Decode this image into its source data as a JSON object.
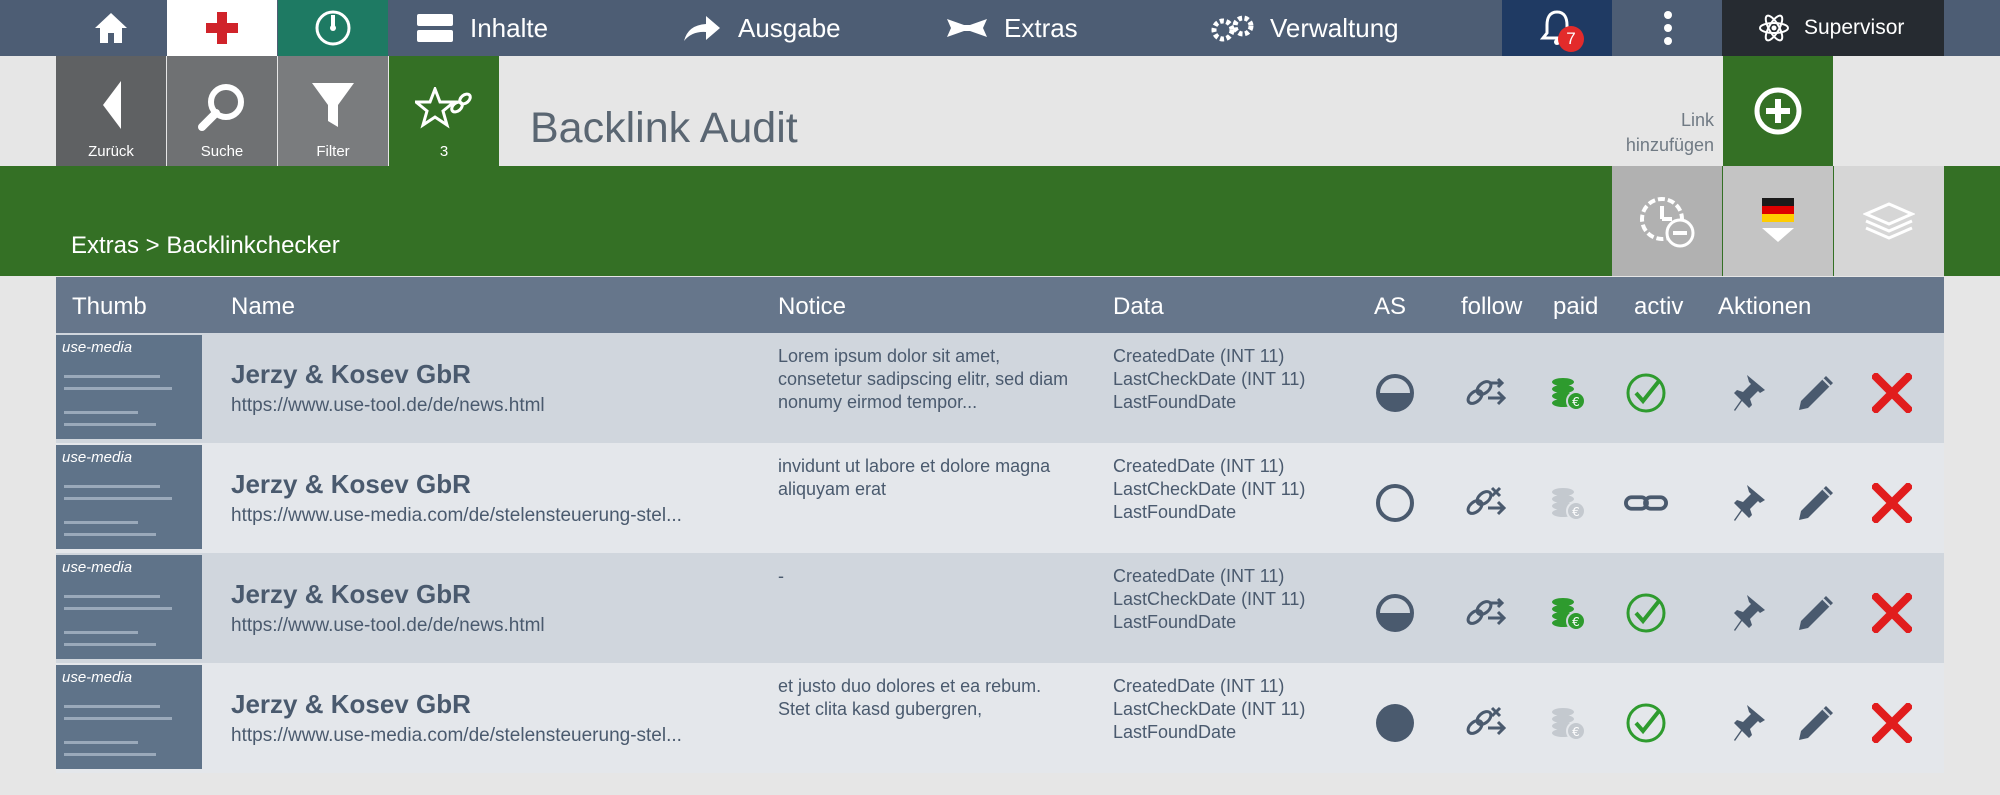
{
  "topnav": {
    "menu": [
      "Inhalte",
      "Ausgabe",
      "Extras",
      "Verwaltung"
    ],
    "notification_count": "7",
    "user": "Supervisor",
    "colors": {
      "bar": "#4d5d74",
      "active_red": "#e32b2b",
      "timer": "#1e7a63",
      "bell": "#1f3a63",
      "user": "#262b31"
    }
  },
  "toolbar": {
    "back_label": "Zurück",
    "search_label": "Suche",
    "filter_label": "Filter",
    "links_count": "3",
    "page_title": "Backlink Audit",
    "add_link_label_1": "Link",
    "add_link_label_2": "hinzufügen"
  },
  "breadcrumb": "Extras > Backlinkchecker",
  "table": {
    "headers": [
      "Thumb",
      "Name",
      "Notice",
      "Data",
      "AS",
      "follow",
      "paid",
      "activ",
      "Aktionen"
    ],
    "rows": [
      {
        "name": "Jerzy & Kosev GbR",
        "url": "https://www.use-tool.de/de/news.html",
        "notice": "Lorem ipsum dolor sit amet, consetetur sadipscing elitr, sed diam nonumy eirmod tempor...",
        "data": [
          "CreatedDate (INT 11)",
          "LastCheckDate (INT 11)",
          "LastFoundDate"
        ],
        "as": "half",
        "follow": "follow",
        "paid": true,
        "activ": true
      },
      {
        "name": "Jerzy & Kosev GbR",
        "url": "https://www.use-media.com/de/stelensteuerung-stel...",
        "notice": "invidunt ut labore et dolore magna aliquyam erat",
        "data": [
          "CreatedDate (INT 11)",
          "LastCheckDate (INT 11)",
          "LastFoundDate"
        ],
        "as": "empty",
        "follow": "nofollow",
        "paid": false,
        "activ": false
      },
      {
        "name": "Jerzy & Kosev GbR",
        "url": "https://www.use-tool.de/de/news.html",
        "notice": "-",
        "data": [
          "CreatedDate (INT 11)",
          "LastCheckDate (INT 11)",
          "LastFoundDate"
        ],
        "as": "half",
        "follow": "follow",
        "paid": true,
        "activ": true
      },
      {
        "name": "Jerzy & Kosev GbR",
        "url": "https://www.use-media.com/de/stelensteuerung-stel...",
        "notice": "et justo duo dolores et ea rebum. Stet clita kasd gubergren,",
        "data": [
          "CreatedDate (INT 11)",
          "LastCheckDate (INT 11)",
          "LastFoundDate"
        ],
        "as": "full",
        "follow": "nofollow",
        "paid": false,
        "activ": true
      }
    ]
  },
  "thumb_logo": "use-media",
  "icons": {
    "home": "home-icon",
    "add": "red-cross-icon",
    "timer": "timer-icon",
    "inhalte": "content-block-icon",
    "ausgabe": "share-arrow-icon",
    "extras": "ribbon-icon",
    "verwaltung": "gears-icon",
    "bell": "bell-icon",
    "more": "kebab-menu-icon",
    "user": "atom-icon"
  }
}
